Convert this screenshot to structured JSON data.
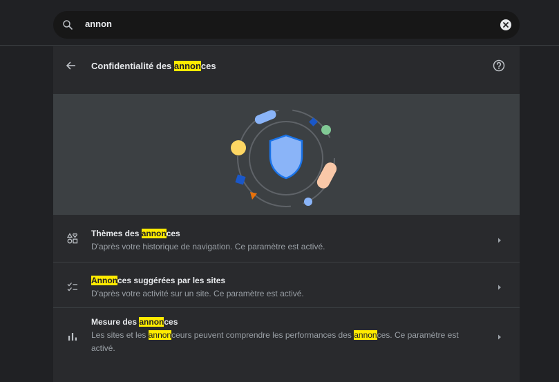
{
  "search": {
    "query": "annon"
  },
  "header": {
    "title_pre": "Confidentialité des ",
    "title_hl": "annon",
    "title_post": "ces"
  },
  "rows": [
    {
      "title_pre": "Thèmes des ",
      "title_hl": "annon",
      "title_post": "ces",
      "desc": "D'après votre historique de navigation. Ce paramètre est activé."
    },
    {
      "title_pre": "",
      "title_hl": "Annon",
      "title_post": "ces suggérées par les sites",
      "desc": "D'après votre activité sur un site. Ce paramètre est activé."
    },
    {
      "title_pre": "Mesure des ",
      "title_hl": "annon",
      "title_post": "ces",
      "desc_1": "Les sites et les ",
      "desc_hl1": "annon",
      "desc_2": "ceurs peuvent comprendre les performances des ",
      "desc_hl2": "annon",
      "desc_3": "ces. Ce paramètre est activé."
    }
  ],
  "colors": {
    "highlight": "#ffeb00",
    "background": "#202124",
    "card": "#292a2d",
    "hero": "#3c4043",
    "shield": "#8ab4f8"
  }
}
